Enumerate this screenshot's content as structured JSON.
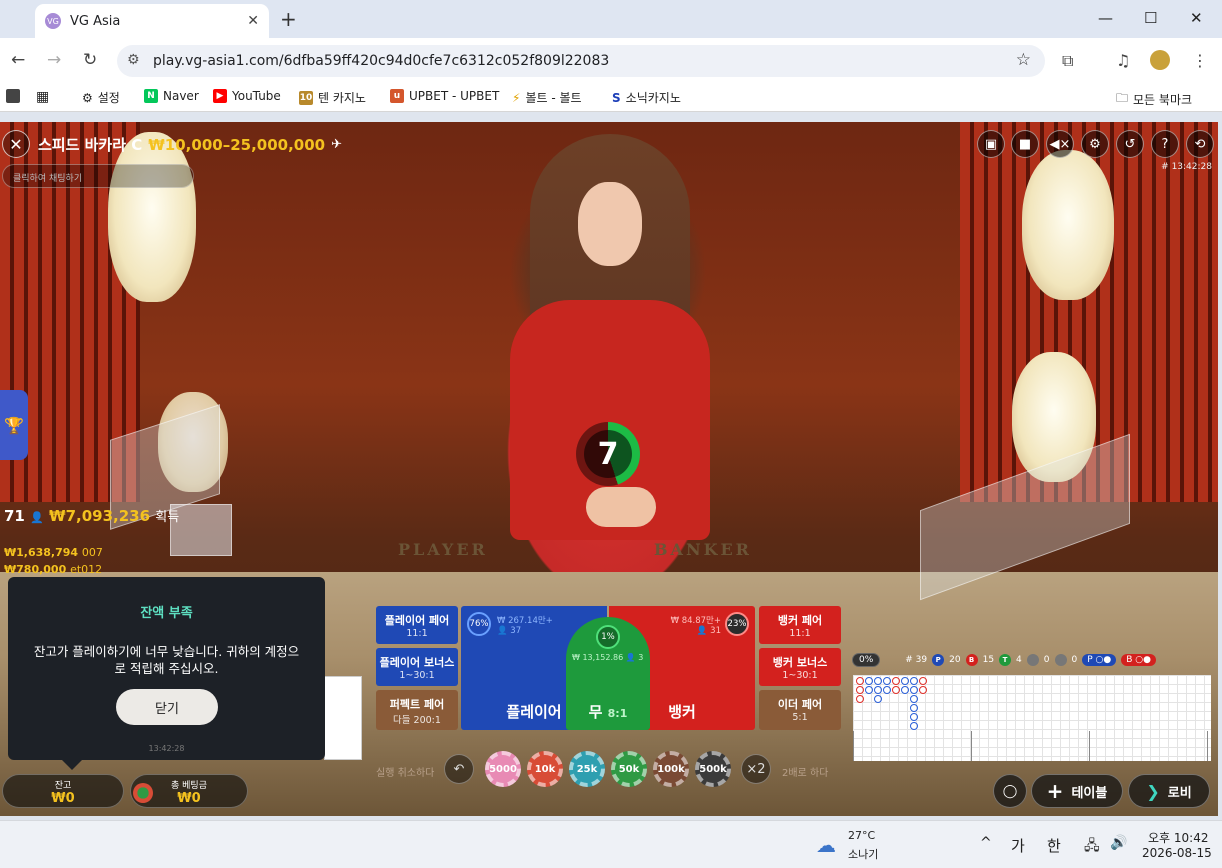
{
  "browser": {
    "tab_title": "VG Asia",
    "favicon_text": "VG",
    "url": "play.vg-asia1.com/6dfba59ff420c94d0cfe7c6312c052f809l22083",
    "bookmarks": [
      {
        "label": "설정",
        "icon": "gear-icon"
      },
      {
        "label": "Naver",
        "icon": "naver-icon"
      },
      {
        "label": "YouTube",
        "icon": "youtube-icon"
      },
      {
        "label": "텐 카지노",
        "icon": "ten-casino-icon"
      },
      {
        "label": "UPBET - UPBET",
        "icon": "upbet-icon"
      },
      {
        "label": "볼트 - 볼트",
        "icon": "bolt-icon"
      },
      {
        "label": "소닉카지노",
        "icon": "sonic-icon"
      }
    ],
    "all_bookmarks": "모든 북마크"
  },
  "game": {
    "table_name": "스피드 바카라 C",
    "limits": "₩10,000–25,000,000",
    "chat_placeholder": "클릭하여 채팅하기",
    "game_id": "# 13:42:28",
    "timer": "7",
    "table_print": {
      "player": "PLAYER",
      "banker": "BANKER"
    },
    "winners": {
      "count": "71",
      "amount": "₩7,093,236",
      "suffix": "획득"
    },
    "winner_list": [
      {
        "amount": "₩1,638,794",
        "user": "007"
      },
      {
        "amount": "₩780,000",
        "user": "et012"
      }
    ]
  },
  "popup": {
    "title": "잔액 부족",
    "message": "잔고가 플레이하기에 너무 낮습니다. 귀하의 계정으로 적립해 주십시오.",
    "button": "닫기",
    "time": "13:42:28"
  },
  "bets": {
    "player_pair": {
      "label": "플레이어 페어",
      "odds": "11:1"
    },
    "player_bonus": {
      "label": "플레이어 보너스",
      "odds": "1~30:1"
    },
    "perfect_pair": {
      "label": "퍼펙트 페어",
      "odds": "다들 200:1"
    },
    "player": {
      "label": "플레이어",
      "pct": "76%",
      "amount": "₩ 267.14만+",
      "players": "37"
    },
    "tie": {
      "label": "무",
      "odds": "8:1",
      "pct": "1%",
      "amount": "₩ 13,152.86",
      "players": "3"
    },
    "banker": {
      "label": "뱅커",
      "pct": "23%",
      "amount": "₩ 84.87만+",
      "players": "31"
    },
    "banker_pair": {
      "label": "뱅커 페어",
      "odds": "11:1"
    },
    "banker_bonus": {
      "label": "뱅커 보너스",
      "odds": "1~30:1"
    },
    "either_pair": {
      "label": "이더 페어",
      "odds": "5:1"
    }
  },
  "chips": [
    "5000",
    "10k",
    "25k",
    "50k",
    "100k",
    "500k"
  ],
  "controls": {
    "undo_label": "실행 취소하다",
    "double_label": "2배로 하다",
    "double_btn": "×2"
  },
  "bottom": {
    "balance_label": "잔고",
    "balance": "₩0",
    "total_bet_label": "총 베팅금",
    "total_bet": "₩0",
    "tables_btn": "테이블",
    "lobby_btn": "로비"
  },
  "scoreboard": {
    "pct": "0%",
    "rounds": "# 39",
    "player": "20",
    "banker": "15",
    "tie": "4",
    "player_pair": "0",
    "banker_pair": "0"
  },
  "taskbar": {
    "temp": "27°C",
    "weather": "소나기",
    "ime1": "가",
    "ime2": "한",
    "time": "오후 10:42",
    "date": "2026-08-15"
  },
  "colors": {
    "accent_gold": "#f4c21f",
    "player_blue": "#1f49b5",
    "banker_red": "#d3211e",
    "tie_green": "#1e9a3c"
  }
}
